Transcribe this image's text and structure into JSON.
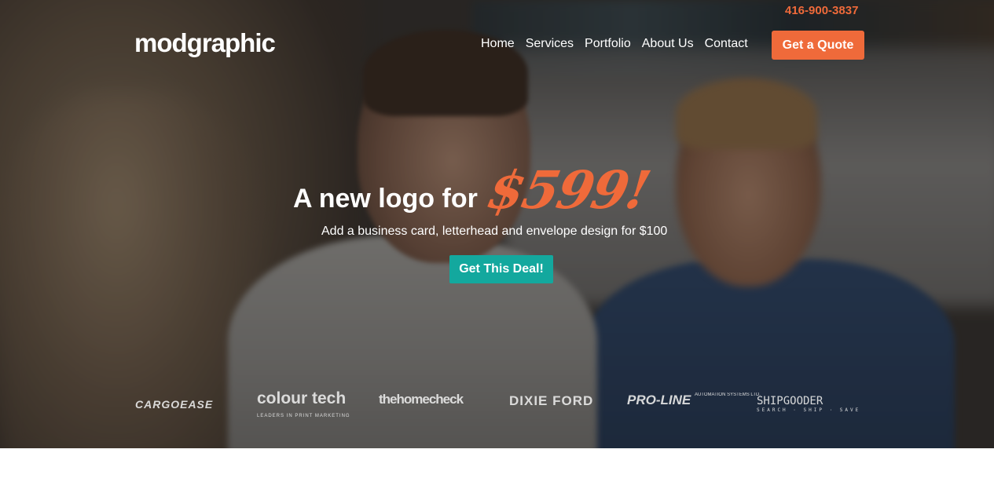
{
  "header": {
    "phone": "416-900-3837",
    "logo_text": "modgraphic",
    "nav": [
      "Home",
      "Services",
      "Portfolio",
      "About Us",
      "Contact"
    ],
    "cta_label": "Get a Quote"
  },
  "hero": {
    "headline": "A new logo for",
    "price": "$599!",
    "subheadline": "Add a business card, letterhead and envelope design for $100",
    "button_label": "Get This Deal!"
  },
  "clients": [
    {
      "name": "CARGOEASE",
      "tagline": ""
    },
    {
      "name": "colour tech",
      "tagline": "LEADERS IN PRINT MARKETING"
    },
    {
      "name": "thehomecheck",
      "tagline": ""
    },
    {
      "name": "DIXIE FORD",
      "tagline": ""
    },
    {
      "name": "PRO-LINE",
      "tagline": "AUTOMATION SYSTEMS LTD."
    },
    {
      "name": "SHIPGOODER",
      "tagline": "SEARCH · SHIP · SAVE"
    }
  ],
  "colors": {
    "accent_orange": "#ef6a3a",
    "accent_teal": "#13a89e"
  }
}
